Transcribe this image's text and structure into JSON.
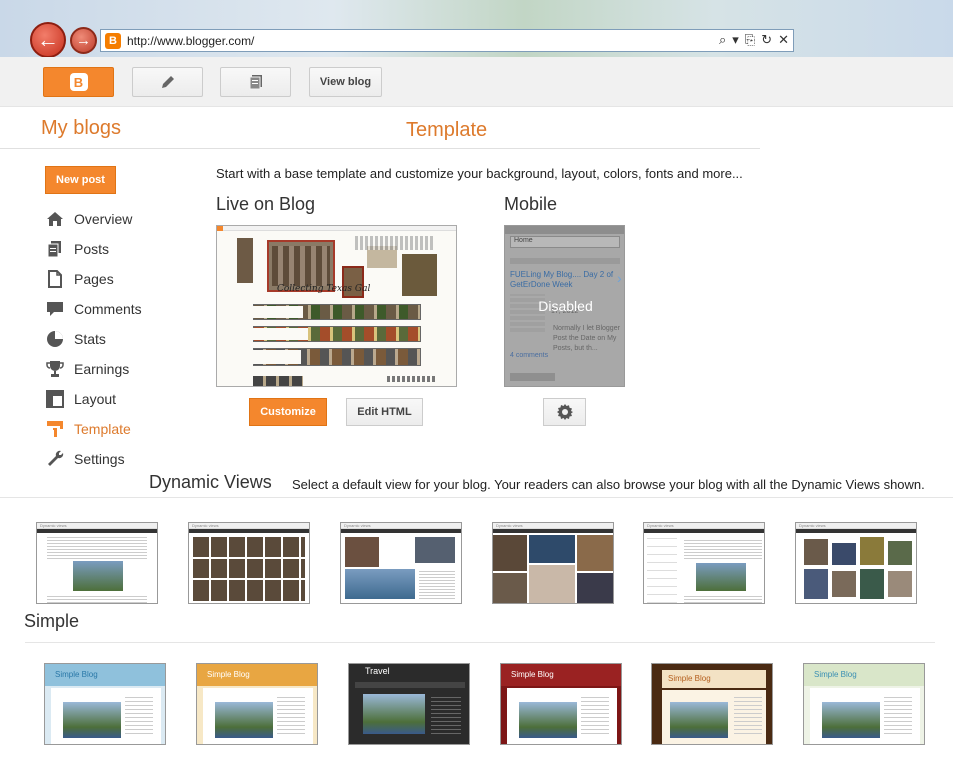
{
  "browser": {
    "url": "http://www.blogger.com/",
    "favicon_letter": "B",
    "back_glyph": "←",
    "forward_glyph": "→",
    "tools": [
      "⌕",
      "▾",
      "⎘",
      "↻",
      "✕"
    ]
  },
  "toolbar": {
    "view_blog_label": "View blog"
  },
  "header": {
    "my_blogs_label": "My blogs",
    "page_title": "Template"
  },
  "sidebar": {
    "new_post_label": "New post",
    "items": [
      {
        "label": "Overview",
        "icon": "home-icon"
      },
      {
        "label": "Posts",
        "icon": "posts-icon"
      },
      {
        "label": "Pages",
        "icon": "pages-icon"
      },
      {
        "label": "Comments",
        "icon": "comments-icon"
      },
      {
        "label": "Stats",
        "icon": "stats-icon"
      },
      {
        "label": "Earnings",
        "icon": "trophy-icon"
      },
      {
        "label": "Layout",
        "icon": "layout-icon"
      },
      {
        "label": "Template",
        "icon": "template-icon"
      },
      {
        "label": "Settings",
        "icon": "wrench-icon"
      }
    ],
    "active_item": "Template"
  },
  "main": {
    "intro": "Start with a base template and customize your background, layout, colors, fonts and more...",
    "live_heading": "Live on Blog",
    "live_blog_title": "Collecting Texas Gal",
    "mobile_heading": "Mobile",
    "mobile_preview": {
      "home_label": "Home",
      "post_title": "FUELing My Blog.... Day 2 of GetErDone Week",
      "post_date": "17, 2012",
      "post_excerpt": "Normally I let Blogger Post the Date on My Posts, but th...",
      "comments": "4 comments",
      "disabled_label": "Disabled"
    },
    "customize_label": "Customize",
    "edit_html_label": "Edit HTML"
  },
  "dynamic_views": {
    "heading": "Dynamic Views",
    "description": "Select a default view for your blog. Your readers can also browse your blog with all the Dynamic Views shown.",
    "thumb_header": "Dynamic views"
  },
  "simple": {
    "heading": "Simple",
    "themes": [
      {
        "title": "Simple Blog",
        "bg": "#dbeaf3",
        "head": "#8fc1dc",
        "title_color": "#2a78a8"
      },
      {
        "title": "Simple Blog",
        "bg": "#f7e8c6",
        "head": "#e8a642",
        "title_color": "#fff"
      },
      {
        "title": "Travel",
        "bg": "#2b2b2b",
        "head": "#3a3a3a",
        "title_color": "#fff"
      },
      {
        "title": "Simple Blog",
        "bg": "#7d1616",
        "head": "#9a2222",
        "title_color": "#fff"
      },
      {
        "title": "Simple Blog",
        "bg": "#4a2a12",
        "head": "#f3e2c4",
        "title_color": "#b45f1e"
      },
      {
        "title": "Simple Blog",
        "bg": "#eef3e6",
        "head": "#d9e6c9",
        "title_color": "#3a8fb3"
      }
    ]
  }
}
